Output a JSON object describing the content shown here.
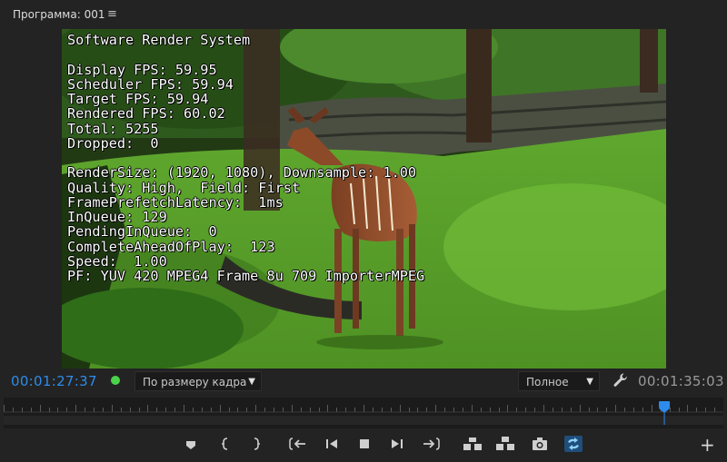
{
  "panel": {
    "title": "Программа: 001",
    "menu_icon": "hamburger-icon"
  },
  "overlay_lines": [
    "Software Render System",
    "",
    "Display FPS: 59.95",
    "Scheduler FPS: 59.94",
    "Target FPS: 59.94",
    "Rendered FPS: 60.02",
    "Total: 5255",
    "Dropped:  0",
    "",
    "RenderSize: (1920, 1080), Downsample: 1.00",
    "Quality: High,  Field: First",
    "FramePrefetchLatency:  1ms",
    "InQueue: 129",
    "PendingInQueue:  0",
    "CompleteAheadOfPlay:  123",
    "Speed:  1.00",
    "PF: YUV 420 MPEG4 Frame 8u 709 ImporterMPEG"
  ],
  "controls": {
    "timecode_current": "00:01:27:37",
    "zoom_select": "По размеру кадра",
    "quality_select": "Полное",
    "timecode_duration": "00:01:35:03"
  },
  "playhead_position": 0.918,
  "colors": {
    "accent_blue": "#2d8ceb",
    "status_green": "#4bd24b",
    "background": "#232323"
  },
  "transport_icons": [
    "add-marker-icon",
    "mark-in-icon",
    "mark-out-icon",
    "go-to-in-icon",
    "step-back-icon",
    "stop-icon",
    "step-forward-icon",
    "go-to-out-icon",
    "lift-icon",
    "extract-icon",
    "export-frame-icon",
    "toggle-proxies-icon",
    "button-editor-icon"
  ]
}
